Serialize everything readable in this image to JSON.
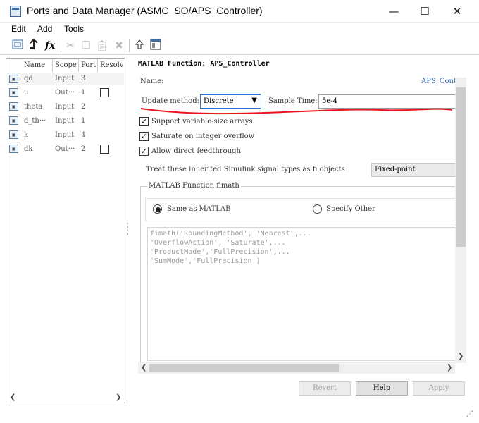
{
  "window": {
    "title": "Ports and Data Manager (ASMC_SO/APS_Controller)",
    "minimize_glyph": "—",
    "maximize_glyph": "☐",
    "close_glyph": "✕"
  },
  "menu": [
    "Edit",
    "Add",
    "Tools"
  ],
  "toolbar": {
    "fx_label": "fx",
    "icons": [
      "new-data-icon",
      "add-data-icon",
      "fx-icon",
      "cut-icon",
      "copy-icon",
      "paste-icon",
      "delete-icon",
      "go-to-parent-icon",
      "model-explorer-icon"
    ]
  },
  "table": {
    "headers": [
      "Name",
      "Scope",
      "Port",
      "Resolve"
    ],
    "rows": [
      {
        "name": "qd",
        "scope": "Input",
        "port": "3",
        "checkbox": false
      },
      {
        "name": "u",
        "scope": "Out···",
        "port": "1",
        "checkbox": true
      },
      {
        "name": "theta",
        "scope": "Input",
        "port": "2",
        "checkbox": false
      },
      {
        "name": "d_th···",
        "scope": "Input",
        "port": "1",
        "checkbox": false
      },
      {
        "name": "k",
        "scope": "Input",
        "port": "4",
        "checkbox": false
      },
      {
        "name": "dk",
        "scope": "Out···",
        "port": "2",
        "checkbox": true
      }
    ]
  },
  "panel": {
    "title": "MATLAB Function: APS_Controller",
    "name_label": "Name:",
    "name_value": "APS_Contr",
    "update_label": "Update method:",
    "update_value": "Discrete",
    "sample_label": "Sample Time:",
    "sample_value": "5e-4",
    "checkboxes": [
      {
        "label": "Support variable-size arrays",
        "checked": true
      },
      {
        "label": "Saturate on integer overflow",
        "checked": true
      },
      {
        "label": "Allow direct feedthrough",
        "checked": true
      }
    ],
    "inherit_label": "Treat these inherited Simulink signal types as fi objects",
    "inherit_value": "Fixed-point",
    "fimath_group": "MATLAB Function fimath",
    "radio_same": "Same as MATLAB",
    "radio_other": "Specify Other",
    "fimath_code": "fimath('RoundingMethod', 'Nearest',...\n'OverflowAction', 'Saturate',...\n'ProductMode','FullPrecision',...\n'SumMode','FullPrecision')"
  },
  "buttons": {
    "revert": "Revert",
    "help": "Help",
    "apply": "Apply"
  },
  "colors": {
    "annotation_red": "#e8141e",
    "link_blue": "#3b6fb6",
    "focus_blue": "#2f6fd1"
  }
}
